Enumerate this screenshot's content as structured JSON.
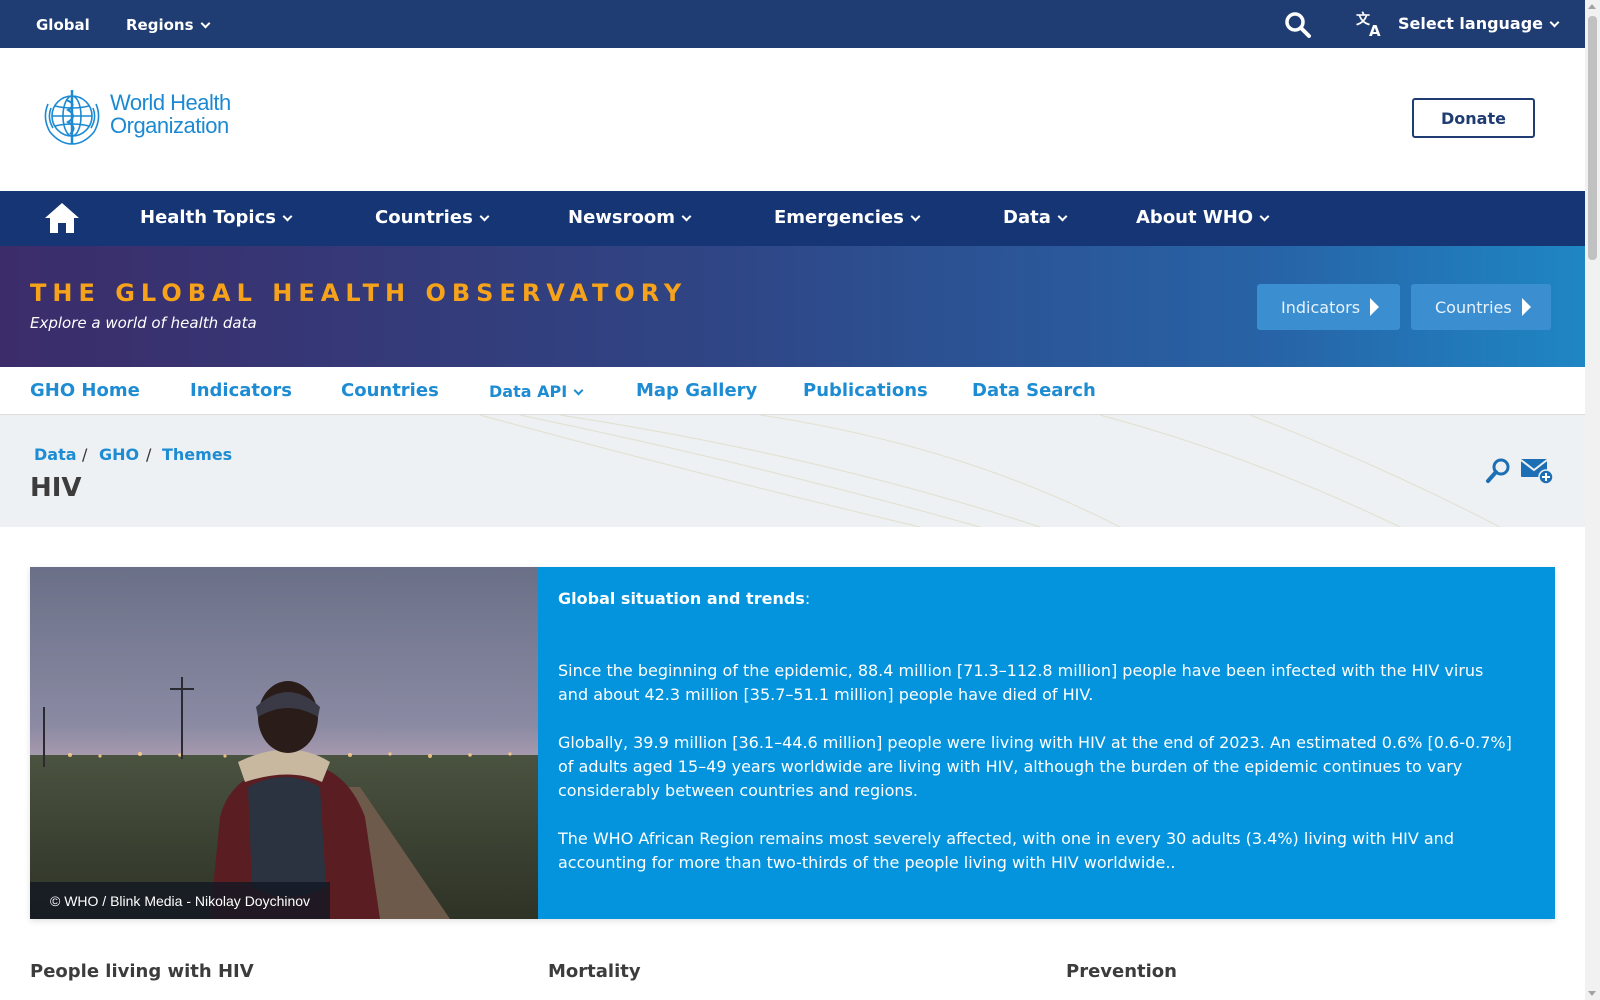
{
  "topbar": {
    "global": "Global",
    "regions": "Regions",
    "language": "Select language"
  },
  "header": {
    "logo_line1": "World Health",
    "logo_line2": "Organization",
    "donate": "Donate"
  },
  "mainnav": {
    "items": [
      "Health Topics",
      "Countries",
      "Newsroom",
      "Emergencies",
      "Data",
      "About WHO"
    ]
  },
  "banner": {
    "title": "THE GLOBAL HEALTH OBSERVATORY",
    "subtitle": "Explore a world of health data",
    "btn_indicators": "Indicators",
    "btn_countries": "Countries"
  },
  "subnav": {
    "items": [
      "GHO Home",
      "Indicators",
      "Countries",
      "Data API",
      "Map Gallery",
      "Publications",
      "Data Search"
    ]
  },
  "breadcrumb": {
    "items": [
      "Data",
      "GHO",
      "Themes"
    ],
    "separator": "/",
    "page_title": "HIV"
  },
  "feature": {
    "caption": "© WHO / Blink Media - Nikolay Doychinov",
    "heading": "Global situation and trends",
    "heading_suffix": ":",
    "paragraphs": [
      "Since the beginning of the epidemic, 88.4 million [71.3–112.8 million]  people have been infected with the HIV virus and about 42.3 million [35.7–51.1 million] people have died of HIV.",
      "Globally, 39.9 million [36.1–44.6 million] people were living with HIV at the end of 2023. An estimated 0.6% [0.6-0.7%] of adults aged 15–49 years worldwide are living with HIV, although the burden of the epidemic continues to vary considerably between countries and regions.",
      "The WHO African Region remains most severely affected, with one in every 30 adults (3.4%) living with HIV and accounting for more than two-thirds of the people living with HIV worldwide.."
    ]
  },
  "sections": [
    "People living with HIV",
    "Mortality",
    "Prevention"
  ],
  "colors": {
    "topbar": "#1f3c73",
    "mainnav": "#163575",
    "banner_title": "#f6a31b",
    "link": "#1d8cd3",
    "feature_bg": "#0394dd"
  }
}
